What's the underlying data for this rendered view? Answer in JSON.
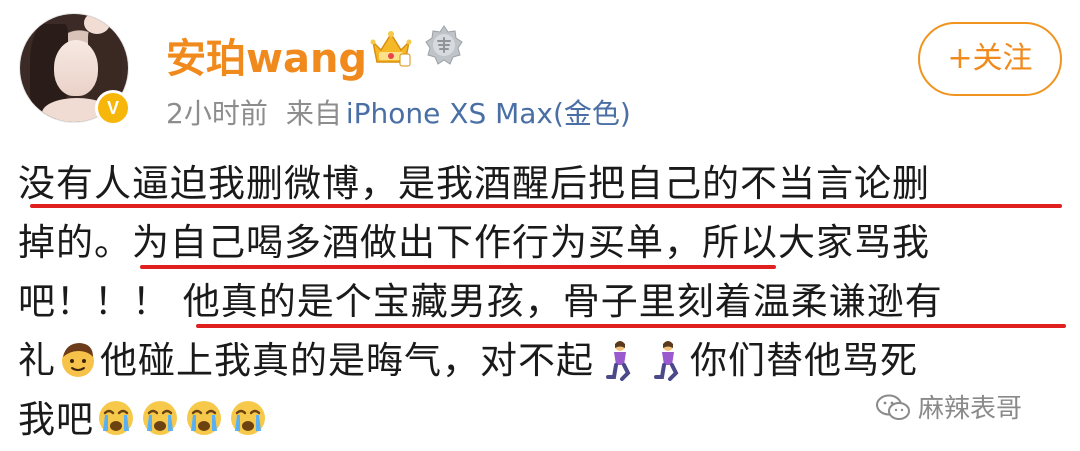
{
  "post": {
    "author": {
      "name": "安珀wang",
      "verified_badge": "V"
    },
    "meta": {
      "time": "2小时前",
      "source_prefix": "来自",
      "source": "iPhone XS Max(金色)"
    },
    "follow_button_label": "+关注",
    "text_lines": [
      "没有人逼迫我删微博，是我酒醒后把自己的不当言论删",
      "掉的。为自己喝多酒做出下作行为买单，所以大家骂我",
      "吧！！！ 他真的是个宝藏男孩，骨子里刻着温柔谦逊有",
      {
        "a": "礼",
        "b": "他碰上我真的是晦气，对不起",
        "c": "你们替他骂死"
      },
      "我吧"
    ],
    "emojis": [
      "boy-emoji",
      "kneeling-woman-emoji",
      "kneeling-woman-emoji",
      "crying-face-emoji"
    ]
  },
  "watermark": {
    "text": "麻辣表哥",
    "icon": "wechat-icon"
  },
  "colors": {
    "username": "#f08a1c",
    "verified": "#f6b60a",
    "source_link": "#4a6fa5",
    "meta": "#8d8d8d",
    "underline": "#e0201f"
  }
}
